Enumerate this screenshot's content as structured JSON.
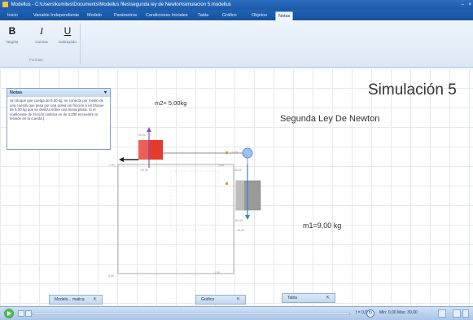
{
  "window": {
    "title": "Modellus - C:\\Users\\kumites\\Documents\\Modellus files\\segunda ley de Newton\\simulacion 5.modellus",
    "min_glyph": "–",
    "close_glyph": "×"
  },
  "menu": {
    "tabs": [
      "Inicio",
      "Variable Independiente",
      "Modelo",
      "Parámetros",
      "Condiciones Iniciales",
      "Tabla",
      "Gráfico",
      "Objetos",
      "Notas"
    ],
    "active": "Notas"
  },
  "ribbon": {
    "bold_glyph": "B",
    "bold_label": "Negrita",
    "italic_glyph": "I",
    "italic_label": "Cursiva",
    "underline_glyph": "U",
    "underline_label": "Subrayado",
    "group_label": "Formato"
  },
  "notes": {
    "header": "Notas",
    "body": "Un bloque que cuelga de 9,00 kg, se conecta por medio de una cuerda que pasa por una polea sin fricción a un bloque de 5,00 kg que se desliza sobre una mesa plana. Si el coeficiente de fricción cinética es de 0,200 encuentre la tensión en la cuerda.]"
  },
  "canvas": {
    "title": "Simulación 5",
    "subtitle": "Segunda Ley De Newton",
    "m2_label": "m2= 5,00kg",
    "m1_label": "m1=9,00 kg"
  },
  "docks": {
    "model_label": "Modelo... matica",
    "graph_label": "Gráfico",
    "table_label": "Tabla",
    "pin_glyph": "⇱"
  },
  "status": {
    "t_readout": "t = 0,00",
    "range_readout": "Min: 0,00 Max: 30,00",
    "refresh_glyph": "↻"
  },
  "colors": {
    "red_block": "#e53b2e",
    "gray_block": "#9a9a9a",
    "pulley": "#9dc3ec",
    "blue_vector": "#3a7fe0",
    "purple_vector": "#8a4fc9"
  }
}
